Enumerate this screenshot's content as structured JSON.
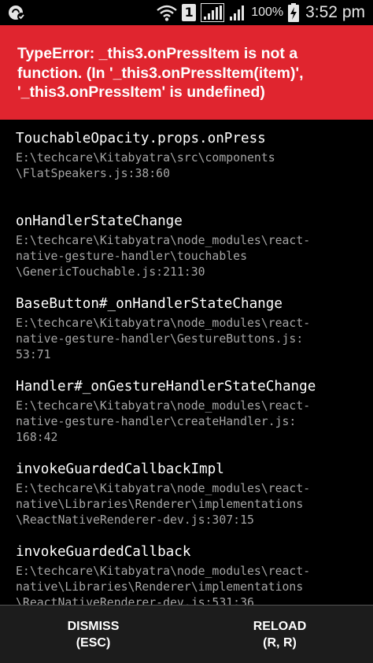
{
  "status_bar": {
    "sim_slot": "1",
    "battery_percent": "100%",
    "time": "3:52 pm",
    "icons": [
      "app-notification-icon",
      "wifi-icon",
      "sim-1-icon",
      "signal-icon-1",
      "signal-icon-2",
      "battery-charging-icon"
    ]
  },
  "error": {
    "message": "TypeError: _this3.onPressItem is not a function. (In '_this3.onPressItem(item)', '_this3.onPressItem' is undefined)",
    "background_color": "#e0252f"
  },
  "stack_frames": [
    {
      "method": "TouchableOpacity.props.onPress",
      "file": "E:\\techcare\\Kitabyatra\\src\\components\n\\FlatSpeakers.js:38:60"
    },
    {
      "method": "onHandlerStateChange",
      "file": "E:\\techcare\\Kitabyatra\\node_modules\\react-\nnative-gesture-handler\\touchables\n\\GenericTouchable.js:211:30"
    },
    {
      "method": "BaseButton#_onHandlerStateChange",
      "file": "E:\\techcare\\Kitabyatra\\node_modules\\react-\nnative-gesture-handler\\GestureButtons.js:\n53:71"
    },
    {
      "method": "Handler#_onGestureHandlerStateChange",
      "file": "E:\\techcare\\Kitabyatra\\node_modules\\react-\nnative-gesture-handler\\createHandler.js:\n168:42"
    },
    {
      "method": "invokeGuardedCallbackImpl",
      "file": "E:\\techcare\\Kitabyatra\\node_modules\\react-\nnative\\Libraries\\Renderer\\implementations\n\\ReactNativeRenderer-dev.js:307:15"
    },
    {
      "method": "invokeGuardedCallback",
      "file": "E:\\techcare\\Kitabyatra\\node_modules\\react-\nnative\\Libraries\\Renderer\\implementations\n\\ReactNativeRenderer-dev.js:531:36"
    }
  ],
  "buttons": {
    "dismiss": {
      "label": "DISMISS",
      "shortcut": "(ESC)"
    },
    "reload": {
      "label": "RELOAD",
      "shortcut": "(R, R)"
    }
  }
}
